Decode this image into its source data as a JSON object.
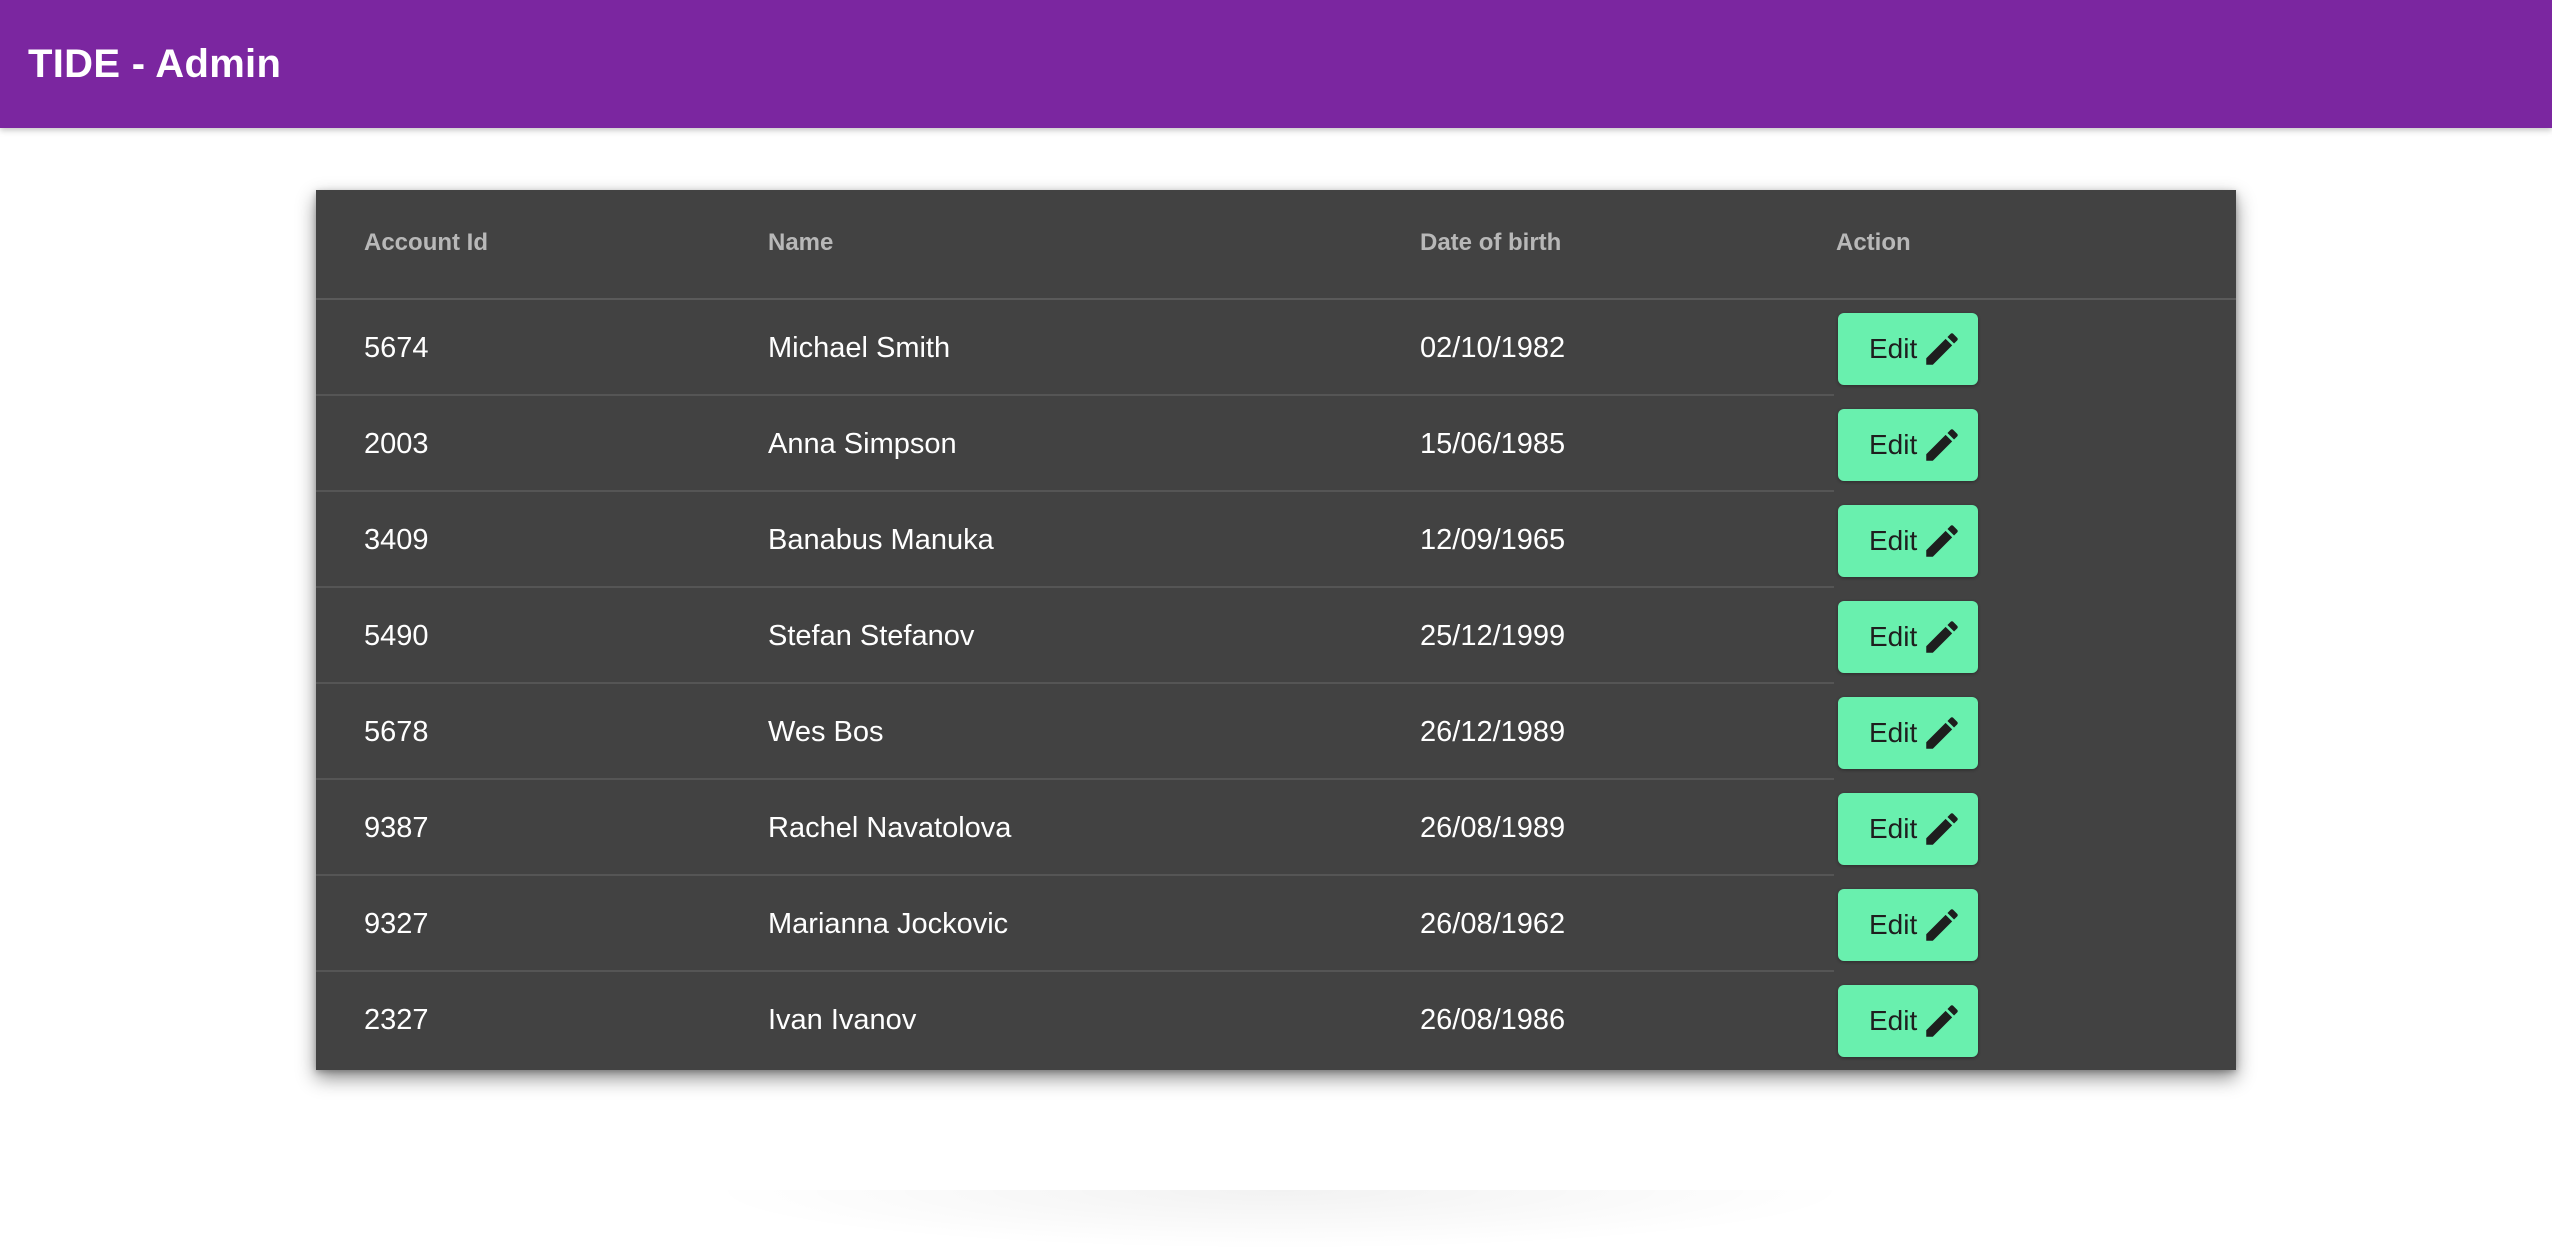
{
  "app": {
    "title": "TIDE - Admin",
    "theme_color": "#7b26a0"
  },
  "table": {
    "background_color": "#424242",
    "columns": [
      "Account Id",
      "Name",
      "Date of birth",
      "Action"
    ],
    "rows": [
      {
        "account_id": "5674",
        "name": "Michael Smith",
        "dob": "02/10/1982",
        "action": "Edit"
      },
      {
        "account_id": "2003",
        "name": "Anna Simpson",
        "dob": "15/06/1985",
        "action": "Edit"
      },
      {
        "account_id": "3409",
        "name": "Banabus Manuka",
        "dob": "12/09/1965",
        "action": "Edit"
      },
      {
        "account_id": "5490",
        "name": "Stefan Stefanov",
        "dob": "25/12/1999",
        "action": "Edit"
      },
      {
        "account_id": "5678",
        "name": "Wes Bos",
        "dob": "26/12/1989",
        "action": "Edit"
      },
      {
        "account_id": "9387",
        "name": "Rachel Navatolova",
        "dob": "26/08/1989",
        "action": "Edit"
      },
      {
        "account_id": "9327",
        "name": "Marianna Jockovic",
        "dob": "26/08/1962",
        "action": "Edit"
      },
      {
        "account_id": "2327",
        "name": "Ivan Ivanov",
        "dob": "26/08/1986",
        "action": "Edit"
      }
    ],
    "edit_button_color": "#69f0ae",
    "edit_icon": "pencil-icon"
  }
}
